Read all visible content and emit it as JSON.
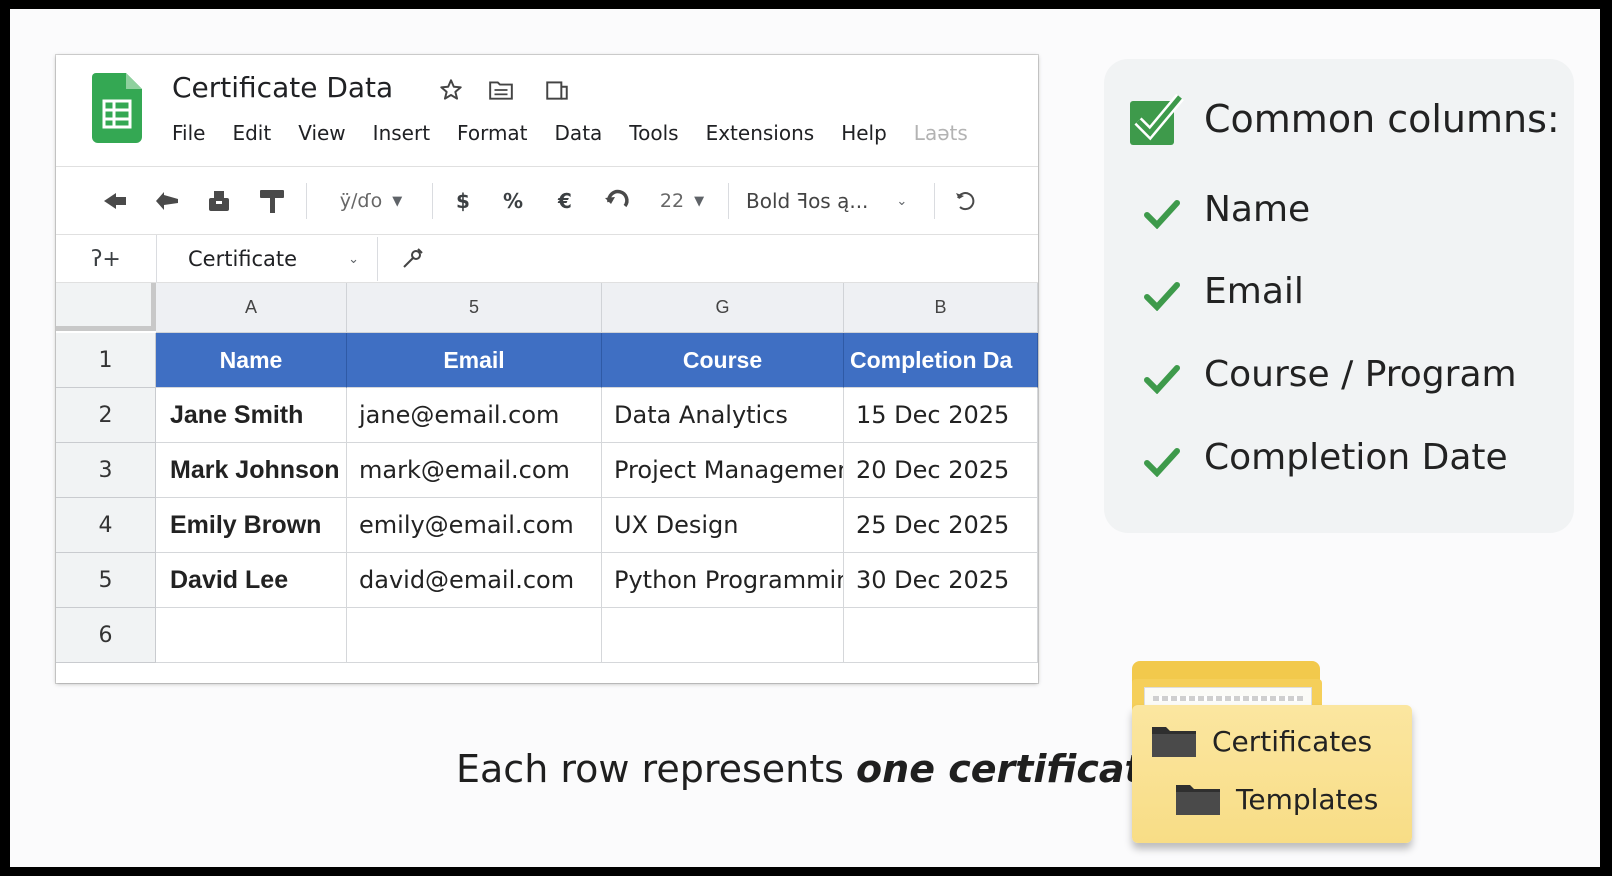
{
  "document": {
    "title": "Certificate Data",
    "menu": [
      "File",
      "Edit",
      "View",
      "Insert",
      "Format",
      "Data",
      "Tools",
      "Extensions",
      "Help",
      "Laəts"
    ]
  },
  "toolbar": {
    "zoom_label": "ÿ∕ɗo",
    "font_size": "22",
    "font_style": "Bold ꟻos ą...",
    "currency": "$",
    "percent": "%",
    "euro": "€"
  },
  "formula_bar": {
    "cell_ref": "ʔ+",
    "name_box": "Certificate"
  },
  "grid": {
    "column_letters": [
      "A",
      "5",
      "G",
      "B"
    ],
    "row_numbers": [
      "1",
      "2",
      "3",
      "4",
      "5",
      "6"
    ],
    "header": [
      "Name",
      "Email",
      "Course",
      "Completion Da"
    ],
    "rows": [
      [
        "Jane Smith",
        "jane@email.com",
        "Data Analytics",
        "15 Dec 2025"
      ],
      [
        "Mark Johnson",
        "mark@email.com",
        "Project Managemen",
        "20 Dec 2025"
      ],
      [
        "Emily Brown",
        "emily@email.com",
        "UX Design",
        "25 Dec 2025"
      ],
      [
        "David Lee",
        "david@email.com",
        "Python Programming",
        "30 Dec 2025"
      ],
      [
        "",
        "",
        "",
        ""
      ]
    ]
  },
  "panel": {
    "title": "Common columns:",
    "items": [
      "Name",
      "Email",
      "Course / Program",
      "Completion Date"
    ]
  },
  "caption": {
    "prefix": "Each row represents ",
    "emphasis": "one certificate"
  },
  "folder": {
    "items": [
      "Certificates",
      "Templates"
    ]
  },
  "colors": {
    "header_blue": "#3f6fc3",
    "check_green": "#3e9a4b",
    "folder_yellow": "#f8dd86"
  }
}
